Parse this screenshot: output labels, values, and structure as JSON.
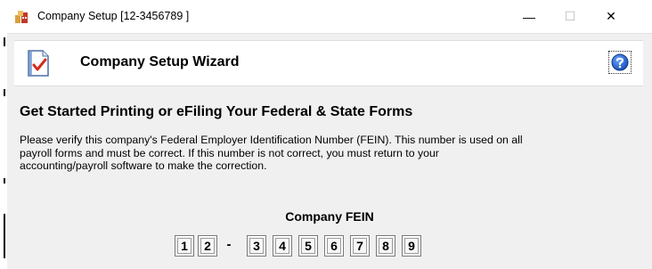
{
  "window": {
    "title": "Company Setup [12-3456789 ]",
    "controls": {
      "minimize": "—",
      "maximize": "☐",
      "close": "✕"
    }
  },
  "wizard": {
    "title": "Company Setup Wizard",
    "icon": "checklist-document-icon",
    "help_icon": "help-icon"
  },
  "content": {
    "heading": "Get Started Printing or eFiling Your Federal & State Forms",
    "description_lines": [
      "Please verify this company's Federal Employer Identification Number (FEIN). This number is used on all",
      "payroll forms and must be correct. If this number is not correct, you must return to your",
      "accounting/payroll software to make the correction."
    ]
  },
  "fein": {
    "label": "Company FEIN",
    "prefix_digits": [
      "1",
      "2"
    ],
    "separator": "-",
    "suffix_digits": [
      "3",
      "4",
      "5",
      "6",
      "7",
      "8",
      "9"
    ]
  },
  "colors": {
    "window_bg": "#f0f0f0",
    "header_bg": "#ffffff",
    "help_blue": "#1f5fc8",
    "check_red": "#d62b1f"
  }
}
